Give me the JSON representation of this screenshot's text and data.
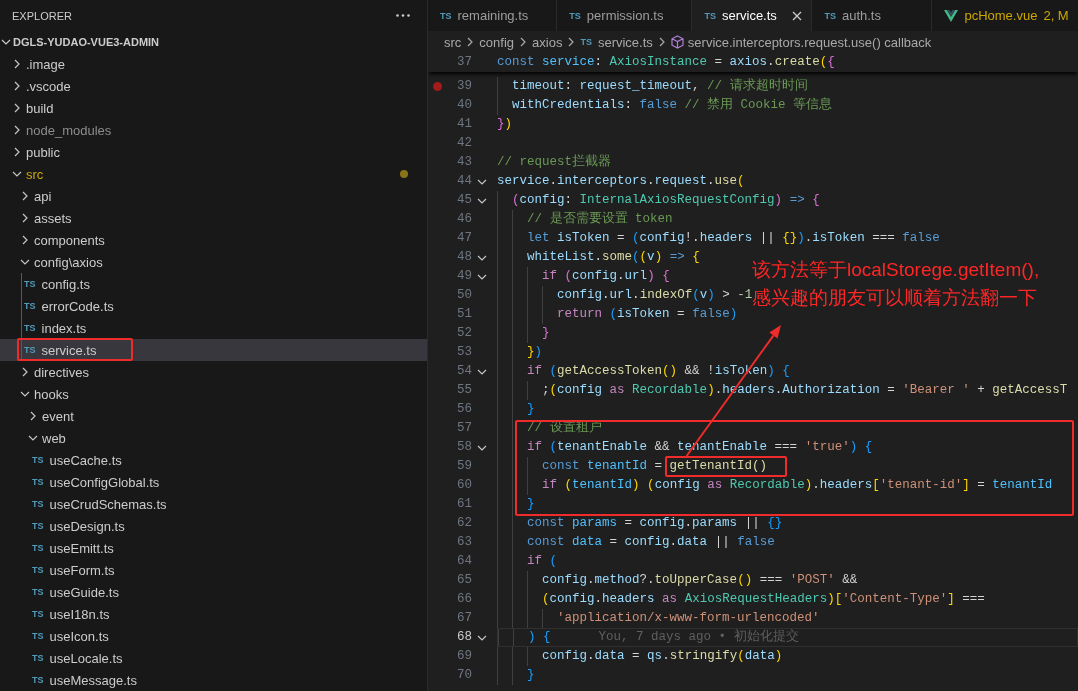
{
  "sidebar": {
    "title": "EXPLORER",
    "root": {
      "label": "DGLS-YUDAO-VUE3-ADMIN",
      "expanded": true,
      "children": [
        {
          "kind": "folder",
          "label": ".image",
          "expanded": false,
          "selected": false,
          "modified": false,
          "ignored": false
        },
        {
          "kind": "folder",
          "label": ".vscode",
          "expanded": false,
          "selected": false,
          "modified": false,
          "ignored": false
        },
        {
          "kind": "folder",
          "label": "build",
          "expanded": false,
          "selected": false,
          "modified": false,
          "ignored": false
        },
        {
          "kind": "folder",
          "label": "node_modules",
          "expanded": false,
          "selected": false,
          "modified": false,
          "ignored": true
        },
        {
          "kind": "folder",
          "label": "public",
          "expanded": false,
          "selected": false,
          "modified": false,
          "ignored": false
        },
        {
          "kind": "folder",
          "label": "src",
          "expanded": true,
          "selected": false,
          "modified": true,
          "ignored": false,
          "children": [
            {
              "kind": "folder",
              "label": "api",
              "expanded": false,
              "selected": false
            },
            {
              "kind": "folder",
              "label": "assets",
              "expanded": false,
              "selected": false
            },
            {
              "kind": "folder",
              "label": "components",
              "expanded": false,
              "selected": false
            },
            {
              "kind": "folder",
              "label": "config\\axios",
              "expanded": true,
              "selected": false,
              "children": [
                {
                  "kind": "file",
                  "icon": "TS",
                  "label": "config.ts",
                  "selected": false,
                  "annotated": false
                },
                {
                  "kind": "file",
                  "icon": "TS",
                  "label": "errorCode.ts",
                  "selected": false,
                  "annotated": false
                },
                {
                  "kind": "file",
                  "icon": "TS",
                  "label": "index.ts",
                  "selected": false,
                  "annotated": false
                },
                {
                  "kind": "file",
                  "icon": "TS",
                  "label": "service.ts",
                  "selected": true,
                  "annotated": true
                }
              ]
            },
            {
              "kind": "folder",
              "label": "directives",
              "expanded": false,
              "selected": false
            },
            {
              "kind": "folder",
              "label": "hooks",
              "expanded": true,
              "selected": false,
              "children": [
                {
                  "kind": "folder",
                  "label": "event",
                  "expanded": false,
                  "selected": false
                },
                {
                  "kind": "folder",
                  "label": "web",
                  "expanded": true,
                  "selected": false,
                  "children": [
                    {
                      "kind": "file",
                      "icon": "TS",
                      "label": "useCache.ts",
                      "selected": false
                    },
                    {
                      "kind": "file",
                      "icon": "TS",
                      "label": "useConfigGlobal.ts",
                      "selected": false
                    },
                    {
                      "kind": "file",
                      "icon": "TS",
                      "label": "useCrudSchemas.ts",
                      "selected": false
                    },
                    {
                      "kind": "file",
                      "icon": "TS",
                      "label": "useDesign.ts",
                      "selected": false
                    },
                    {
                      "kind": "file",
                      "icon": "TS",
                      "label": "useEmitt.ts",
                      "selected": false
                    },
                    {
                      "kind": "file",
                      "icon": "TS",
                      "label": "useForm.ts",
                      "selected": false
                    },
                    {
                      "kind": "file",
                      "icon": "TS",
                      "label": "useGuide.ts",
                      "selected": false
                    },
                    {
                      "kind": "file",
                      "icon": "TS",
                      "label": "useI18n.ts",
                      "selected": false
                    },
                    {
                      "kind": "file",
                      "icon": "TS",
                      "label": "useIcon.ts",
                      "selected": false
                    },
                    {
                      "kind": "file",
                      "icon": "TS",
                      "label": "useLocale.ts",
                      "selected": false
                    },
                    {
                      "kind": "file",
                      "icon": "TS",
                      "label": "useMessage.ts",
                      "selected": false
                    }
                  ]
                }
              ]
            }
          ]
        }
      ]
    }
  },
  "editor": {
    "tabs": [
      {
        "kind": "ts",
        "icon": "TS",
        "label": "remaining.ts",
        "selected": false,
        "warning": false
      },
      {
        "kind": "ts",
        "icon": "TS",
        "label": "permission.ts",
        "selected": false,
        "warning": false
      },
      {
        "kind": "ts",
        "icon": "TS",
        "label": "service.ts",
        "selected": true,
        "warning": false
      },
      {
        "kind": "ts",
        "icon": "TS",
        "label": "auth.ts",
        "selected": false,
        "warning": false
      },
      {
        "kind": "vue",
        "label": "pcHome.vue",
        "status": "2, M",
        "selected": false,
        "warning": true
      }
    ],
    "breadcrumbs": [
      {
        "kind": "folder",
        "label": "src"
      },
      {
        "kind": "folder",
        "label": "config"
      },
      {
        "kind": "folder",
        "label": "axios"
      },
      {
        "kind": "file",
        "icon": "TS",
        "label": "service.ts"
      },
      {
        "kind": "symbol",
        "label": "service.interceptors.request.use() callback"
      }
    ],
    "sticky_line": {
      "number": "37",
      "tokens": [
        {
          "text": "const",
          "kind": "keyword"
        },
        {
          "text": " service",
          "kind": "constant"
        },
        {
          "text": ": ",
          "kind": "plain"
        },
        {
          "text": "AxiosInstance",
          "kind": "type"
        },
        {
          "text": " = ",
          "kind": "plain"
        },
        {
          "text": "axios",
          "kind": "variable"
        },
        {
          "text": ".",
          "kind": "plain"
        },
        {
          "text": "create",
          "kind": "function"
        },
        {
          "text": "(",
          "kind": "bracket1"
        },
        {
          "text": "{",
          "kind": "bracket2"
        }
      ]
    },
    "blocks": [
      {
        "boxed": false,
        "lines": [
          {
            "number": "39",
            "fold": false,
            "breakpoint": true,
            "current": false,
            "tokens": [
              {
                "text": "  timeout",
                "kind": "variable"
              },
              {
                "text": ": ",
                "kind": "plain"
              },
              {
                "text": "request_timeout",
                "kind": "variable"
              },
              {
                "text": ", ",
                "kind": "plain"
              },
              {
                "text": "// 请求超时时间",
                "kind": "comment"
              }
            ]
          },
          {
            "number": "40",
            "fold": false,
            "breakpoint": false,
            "current": false,
            "tokens": [
              {
                "text": "  withCredentials",
                "kind": "variable"
              },
              {
                "text": ": ",
                "kind": "plain"
              },
              {
                "text": "false",
                "kind": "keyword"
              },
              {
                "text": " // 禁用 Cookie 等信息",
                "kind": "comment"
              }
            ]
          },
          {
            "number": "41",
            "fold": false,
            "breakpoint": false,
            "current": false,
            "tokens": [
              {
                "text": "}",
                "kind": "bracket2"
              },
              {
                "text": ")",
                "kind": "bracket1"
              }
            ]
          },
          {
            "number": "42",
            "fold": false,
            "breakpoint": false,
            "current": false
          },
          {
            "number": "43",
            "fold": false,
            "breakpoint": false,
            "current": false,
            "tokens": [
              {
                "text": "// request拦截器",
                "kind": "comment"
              }
            ]
          },
          {
            "number": "44",
            "fold": true,
            "breakpoint": false,
            "current": false,
            "tokens": [
              {
                "text": "service",
                "kind": "variable"
              },
              {
                "text": ".",
                "kind": "plain"
              },
              {
                "text": "interceptors",
                "kind": "variable"
              },
              {
                "text": ".",
                "kind": "plain"
              },
              {
                "text": "request",
                "kind": "variable"
              },
              {
                "text": ".",
                "kind": "plain"
              },
              {
                "text": "use",
                "kind": "function"
              },
              {
                "text": "(",
                "kind": "bracket1"
              }
            ]
          },
          {
            "number": "45",
            "fold": true,
            "breakpoint": false,
            "current": false,
            "tokens": [
              {
                "text": "  (",
                "kind": "bracket2"
              },
              {
                "text": "config",
                "kind": "variable"
              },
              {
                "text": ": ",
                "kind": "plain"
              },
              {
                "text": "InternalAxiosRequestConfig",
                "kind": "type"
              },
              {
                "text": ")",
                "kind": "bracket2"
              },
              {
                "text": " =>",
                "kind": "keyword"
              },
              {
                "text": " {",
                "kind": "bracket2"
              }
            ]
          },
          {
            "number": "46",
            "fold": false,
            "breakpoint": false,
            "current": false,
            "tokens": [
              {
                "text": "    // 是否需要设置 token",
                "kind": "comment"
              }
            ]
          },
          {
            "number": "47",
            "fold": false,
            "breakpoint": false,
            "current": false,
            "tokens": [
              {
                "text": "    let",
                "kind": "keyword"
              },
              {
                "text": " isToken",
                "kind": "variable"
              },
              {
                "text": " = ",
                "kind": "plain"
              },
              {
                "text": "(",
                "kind": "bracket3"
              },
              {
                "text": "config",
                "kind": "variable"
              },
              {
                "text": "!.",
                "kind": "plain"
              },
              {
                "text": "headers",
                "kind": "variable"
              },
              {
                "text": " || ",
                "kind": "plain"
              },
              {
                "text": "{}",
                "kind": "bracket1"
              },
              {
                "text": ")",
                "kind": "bracket3"
              },
              {
                "text": ".",
                "kind": "plain"
              },
              {
                "text": "isToken",
                "kind": "variable"
              },
              {
                "text": " === ",
                "kind": "plain"
              },
              {
                "text": "false",
                "kind": "keyword"
              }
            ]
          },
          {
            "number": "48",
            "fold": true,
            "breakpoint": false,
            "current": false,
            "tokens": [
              {
                "text": "    whiteList",
                "kind": "variable"
              },
              {
                "text": ".",
                "kind": "plain"
              },
              {
                "text": "some",
                "kind": "function"
              },
              {
                "text": "(",
                "kind": "bracket3"
              },
              {
                "text": "(",
                "kind": "bracket1"
              },
              {
                "text": "v",
                "kind": "variable"
              },
              {
                "text": ")",
                "kind": "bracket1"
              },
              {
                "text": " =>",
                "kind": "keyword"
              },
              {
                "text": " {",
                "kind": "bracket1"
              }
            ]
          },
          {
            "number": "49",
            "fold": true,
            "breakpoint": false,
            "current": false,
            "tokens": [
              {
                "text": "      if",
                "kind": "control"
              },
              {
                "text": " (",
                "kind": "bracket2"
              },
              {
                "text": "config",
                "kind": "variable"
              },
              {
                "text": ".",
                "kind": "plain"
              },
              {
                "text": "url",
                "kind": "variable"
              },
              {
                "text": ")",
                "kind": "bracket2"
              },
              {
                "text": " {",
                "kind": "bracket2"
              }
            ]
          },
          {
            "number": "50",
            "fold": false,
            "breakpoint": false,
            "current": false,
            "tokens": [
              {
                "text": "        config",
                "kind": "variable"
              },
              {
                "text": ".",
                "kind": "plain"
              },
              {
                "text": "url",
                "kind": "variable"
              },
              {
                "text": ".",
                "kind": "plain"
              },
              {
                "text": "indexOf",
                "kind": "function"
              },
              {
                "text": "(",
                "kind": "bracket3"
              },
              {
                "text": "v",
                "kind": "variable"
              },
              {
                "text": ")",
                "kind": "bracket3"
              },
              {
                "text": " > ",
                "kind": "plain"
              },
              {
                "text": "-1",
                "kind": "number"
              }
            ]
          },
          {
            "number": "51",
            "fold": false,
            "breakpoint": false,
            "current": false,
            "tokens": [
              {
                "text": "        return",
                "kind": "control"
              },
              {
                "text": " (",
                "kind": "bracket3"
              },
              {
                "text": "isToken",
                "kind": "variable"
              },
              {
                "text": " = ",
                "kind": "plain"
              },
              {
                "text": "false",
                "kind": "keyword"
              },
              {
                "text": ")",
                "kind": "bracket3"
              }
            ]
          },
          {
            "number": "52",
            "fold": false,
            "breakpoint": false,
            "current": false,
            "tokens": [
              {
                "text": "      }",
                "kind": "bracket2"
              }
            ]
          },
          {
            "number": "53",
            "fold": false,
            "breakpoint": false,
            "current": false,
            "tokens": [
              {
                "text": "    }",
                "kind": "bracket1"
              },
              {
                "text": ")",
                "kind": "bracket3"
              }
            ]
          },
          {
            "number": "54",
            "fold": true,
            "breakpoint": false,
            "current": false,
            "tokens": [
              {
                "text": "    if",
                "kind": "control"
              },
              {
                "text": " (",
                "kind": "bracket3"
              },
              {
                "text": "getAccessToken",
                "kind": "function"
              },
              {
                "text": "()",
                "kind": "bracket1"
              },
              {
                "text": " && !",
                "kind": "plain"
              },
              {
                "text": "isToken",
                "kind": "variable"
              },
              {
                "text": ")",
                "kind": "bracket3"
              },
              {
                "text": " {",
                "kind": "bracket3"
              }
            ]
          },
          {
            "number": "55",
            "fold": false,
            "breakpoint": false,
            "current": false,
            "tokens": [
              {
                "text": "      ;",
                "kind": "plain"
              },
              {
                "text": "(",
                "kind": "bracket1"
              },
              {
                "text": "config",
                "kind": "variable"
              },
              {
                "text": " as",
                "kind": "control"
              },
              {
                "text": " Recordable",
                "kind": "type"
              },
              {
                "text": ")",
                "kind": "bracket1"
              },
              {
                "text": ".",
                "kind": "plain"
              },
              {
                "text": "headers",
                "kind": "variable"
              },
              {
                "text": ".",
                "kind": "plain"
              },
              {
                "text": "Authorization",
                "kind": "variable"
              },
              {
                "text": " = ",
                "kind": "plain"
              },
              {
                "text": "'Bearer '",
                "kind": "string"
              },
              {
                "text": " + ",
                "kind": "plain"
              },
              {
                "text": "getAccessT",
                "kind": "function"
              }
            ]
          },
          {
            "number": "56",
            "fold": false,
            "breakpoint": false,
            "current": false,
            "tokens": [
              {
                "text": "    }",
                "kind": "bracket3"
              }
            ]
          }
        ]
      },
      {
        "boxed": true,
        "lines": [
          {
            "number": "57",
            "fold": false,
            "breakpoint": false,
            "current": false,
            "tokens": [
              {
                "text": "    // 设置租户",
                "kind": "comment"
              }
            ]
          },
          {
            "number": "58",
            "fold": true,
            "breakpoint": false,
            "current": false,
            "tokens": [
              {
                "text": "    if",
                "kind": "control"
              },
              {
                "text": " (",
                "kind": "bracket3"
              },
              {
                "text": "tenantEnable",
                "kind": "variable"
              },
              {
                "text": " && ",
                "kind": "plain"
              },
              {
                "text": "tenantEnable",
                "kind": "variable"
              },
              {
                "text": " === ",
                "kind": "plain"
              },
              {
                "text": "'true'",
                "kind": "string"
              },
              {
                "text": ")",
                "kind": "bracket3"
              },
              {
                "text": " {",
                "kind": "bracket3"
              }
            ]
          },
          {
            "number": "59",
            "fold": false,
            "breakpoint": false,
            "current": false,
            "tokens": [
              {
                "text": "      const",
                "kind": "keyword",
                "boxed": false
              },
              {
                "text": " tenantId",
                "kind": "constant",
                "boxed": false
              },
              {
                "text": " = ",
                "kind": "plain",
                "boxed": false
              },
              {
                "text": "getTenantId()",
                "kind": "function",
                "boxed": true
              }
            ]
          },
          {
            "number": "60",
            "fold": false,
            "breakpoint": false,
            "current": false,
            "tokens": [
              {
                "text": "      if",
                "kind": "control"
              },
              {
                "text": " (",
                "kind": "bracket1"
              },
              {
                "text": "tenantId",
                "kind": "constant"
              },
              {
                "text": ")",
                "kind": "bracket1"
              },
              {
                "text": " (",
                "kind": "bracket1"
              },
              {
                "text": "config",
                "kind": "variable"
              },
              {
                "text": " as",
                "kind": "control"
              },
              {
                "text": " Recordable",
                "kind": "type"
              },
              {
                "text": ")",
                "kind": "bracket1"
              },
              {
                "text": ".",
                "kind": "plain"
              },
              {
                "text": "headers",
                "kind": "variable"
              },
              {
                "text": "[",
                "kind": "bracket1"
              },
              {
                "text": "'tenant-id'",
                "kind": "string"
              },
              {
                "text": "]",
                "kind": "bracket1"
              },
              {
                "text": " = ",
                "kind": "plain"
              },
              {
                "text": "tenantId",
                "kind": "constant"
              }
            ]
          },
          {
            "number": "61",
            "fold": false,
            "breakpoint": false,
            "current": false,
            "tokens": [
              {
                "text": "    }",
                "kind": "bracket3"
              }
            ]
          }
        ]
      },
      {
        "boxed": false,
        "lines": [
          {
            "number": "62",
            "fold": false,
            "breakpoint": false,
            "current": false,
            "tokens": [
              {
                "text": "    const",
                "kind": "keyword"
              },
              {
                "text": " params",
                "kind": "constant"
              },
              {
                "text": " = ",
                "kind": "plain"
              },
              {
                "text": "config",
                "kind": "variable"
              },
              {
                "text": ".",
                "kind": "plain"
              },
              {
                "text": "params",
                "kind": "variable"
              },
              {
                "text": " || ",
                "kind": "plain"
              },
              {
                "text": "{}",
                "kind": "bracket3"
              }
            ]
          },
          {
            "number": "63",
            "fold": false,
            "breakpoint": false,
            "current": false,
            "tokens": [
              {
                "text": "    const",
                "kind": "keyword"
              },
              {
                "text": " data",
                "kind": "constant"
              },
              {
                "text": " = ",
                "kind": "plain"
              },
              {
                "text": "config",
                "kind": "variable"
              },
              {
                "text": ".",
                "kind": "plain"
              },
              {
                "text": "data",
                "kind": "variable"
              },
              {
                "text": " || ",
                "kind": "plain"
              },
              {
                "text": "false",
                "kind": "keyword"
              }
            ]
          },
          {
            "number": "64",
            "fold": false,
            "breakpoint": false,
            "current": false,
            "tokens": [
              {
                "text": "    if",
                "kind": "control"
              },
              {
                "text": " (",
                "kind": "bracket3"
              }
            ]
          },
          {
            "number": "65",
            "fold": false,
            "breakpoint": false,
            "current": false,
            "tokens": [
              {
                "text": "      config",
                "kind": "variable"
              },
              {
                "text": ".",
                "kind": "plain"
              },
              {
                "text": "method",
                "kind": "variable"
              },
              {
                "text": "?.",
                "kind": "plain"
              },
              {
                "text": "toUpperCase",
                "kind": "function"
              },
              {
                "text": "()",
                "kind": "bracket1"
              },
              {
                "text": " === ",
                "kind": "plain"
              },
              {
                "text": "'POST'",
                "kind": "string"
              },
              {
                "text": " &&",
                "kind": "plain"
              }
            ]
          },
          {
            "number": "66",
            "fold": false,
            "breakpoint": false,
            "current": false,
            "tokens": [
              {
                "text": "      (",
                "kind": "bracket1"
              },
              {
                "text": "config",
                "kind": "variable"
              },
              {
                "text": ".",
                "kind": "plain"
              },
              {
                "text": "headers",
                "kind": "variable"
              },
              {
                "text": " as",
                "kind": "control"
              },
              {
                "text": " AxiosRequestHeaders",
                "kind": "type"
              },
              {
                "text": ")",
                "kind": "bracket1"
              },
              {
                "text": "[",
                "kind": "bracket1"
              },
              {
                "text": "'Content-Type'",
                "kind": "string"
              },
              {
                "text": "]",
                "kind": "bracket1"
              },
              {
                "text": " ===",
                "kind": "plain"
              }
            ]
          },
          {
            "number": "67",
            "fold": false,
            "breakpoint": false,
            "current": false,
            "tokens": [
              {
                "text": "        'application/x-www-form-urlencoded'",
                "kind": "string"
              }
            ]
          },
          {
            "number": "68",
            "fold": true,
            "breakpoint": false,
            "current": true,
            "blame": "You, 7 days ago • 初始化提交",
            "tokens": [
              {
                "text": "    )",
                "kind": "bracket3"
              },
              {
                "text": " {",
                "kind": "bracket3"
              }
            ]
          },
          {
            "number": "69",
            "fold": false,
            "breakpoint": false,
            "current": false,
            "tokens": [
              {
                "text": "      config",
                "kind": "variable"
              },
              {
                "text": ".",
                "kind": "plain"
              },
              {
                "text": "data",
                "kind": "variable"
              },
              {
                "text": " = ",
                "kind": "plain"
              },
              {
                "text": "qs",
                "kind": "variable"
              },
              {
                "text": ".",
                "kind": "plain"
              },
              {
                "text": "stringify",
                "kind": "function"
              },
              {
                "text": "(",
                "kind": "bracket1"
              },
              {
                "text": "data",
                "kind": "variable"
              },
              {
                "text": ")",
                "kind": "bracket1"
              }
            ]
          },
          {
            "number": "70",
            "fold": false,
            "breakpoint": false,
            "current": false,
            "tokens": [
              {
                "text": "    }",
                "kind": "bracket3"
              }
            ]
          }
        ]
      }
    ],
    "note": {
      "lines": [
        "该方法等于localStorege.getItem(),",
        "感兴趣的朋友可以顺着方法翻一下"
      ],
      "arrow": true
    }
  }
}
